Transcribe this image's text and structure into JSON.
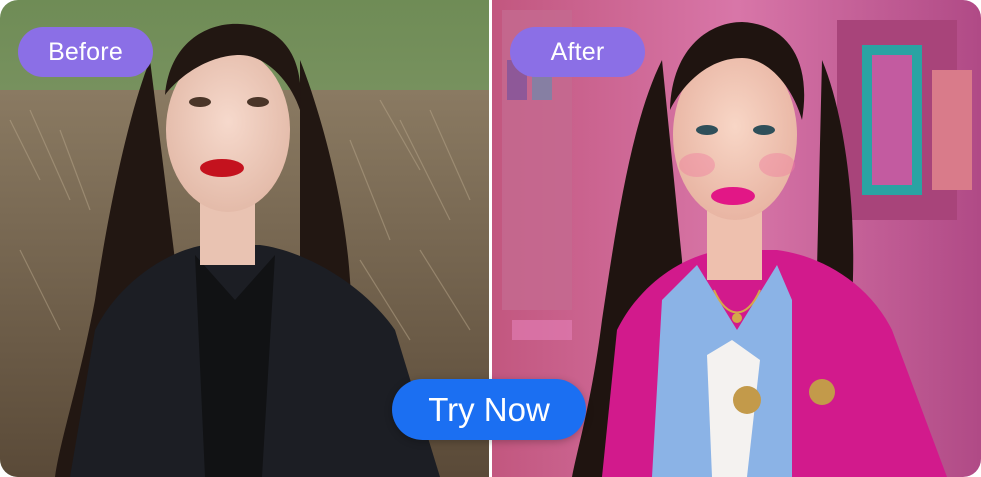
{
  "comparison": {
    "before_label": "Before",
    "after_label": "After"
  },
  "cta": {
    "label": "Try Now"
  },
  "colors": {
    "label_pill": "#8b6fe6",
    "cta_button": "#1b6ff2"
  }
}
